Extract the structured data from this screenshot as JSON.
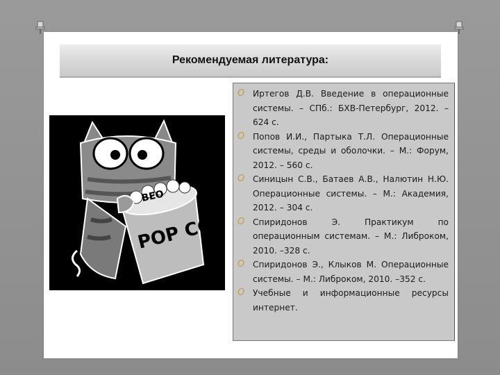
{
  "title": "Рекомендуемая литература:",
  "bullet_color": "#c0a040",
  "image": {
    "popcorn_bag_text": "POP COR",
    "lid_text": "BEO"
  },
  "references": [
    {
      "text": "Иртегов Д.В. Введение в операционные системы. – СПб.: БХВ-Петербург, 2012. – 624 с."
    },
    {
      "text": "Попов И.И., Партыка Т.Л. Операционные системы, среды и оболочки. – М.: Форум, 2012. – 560 с."
    },
    {
      "text": "Синицын С.В., Батаев А.В., Налютин Н.Ю. Операционные системы. – М.: Академия, 2012. – 304 с."
    },
    {
      "text": "Спиридонов Э. Практикум по операционным системам. – М.: Либроком, 2010. –328 с."
    },
    {
      "text": "Спиридонов Э., Клыков М. Операционные системы. – М.: Либроком, 2010. –352 с."
    },
    {
      "text": "Учебные и информационные ресурсы интернет."
    }
  ]
}
